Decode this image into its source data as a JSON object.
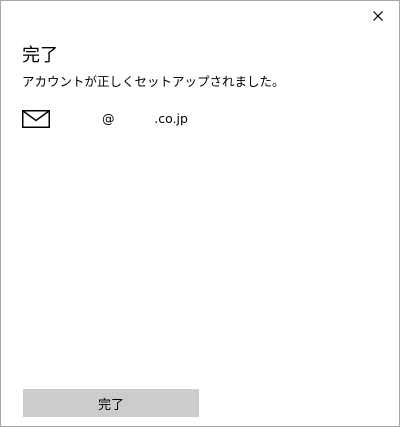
{
  "dialog": {
    "close_glyph": "×",
    "title": "完了",
    "message": "アカウントが正しくセットアップされました。",
    "account": {
      "icon": "mail-icon",
      "email": "@          .co.jp"
    },
    "done_label": "完了"
  },
  "colors": {
    "button_bg": "#cccccc",
    "border": "#a6a6a6",
    "background": "#ffffff",
    "text": "#000000"
  }
}
